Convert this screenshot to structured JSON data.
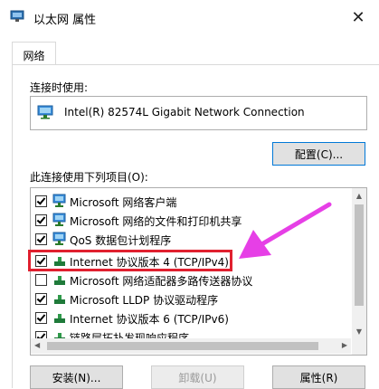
{
  "window": {
    "title": "以太网 属性",
    "close_glyph": "✕"
  },
  "tabs": [
    {
      "label": "网络"
    }
  ],
  "connect_using": {
    "label": "连接时使用:",
    "adapter": "Intel(R) 82574L Gigabit Network Connection",
    "configure_label": "配置(C)..."
  },
  "items_label": "此连接使用下列项目(O):",
  "items": [
    {
      "label": "Microsoft 网络客户端",
      "checked": true
    },
    {
      "label": "Microsoft 网络的文件和打印机共享",
      "checked": true
    },
    {
      "label": "QoS 数据包计划程序",
      "checked": true
    },
    {
      "label": "Internet 协议版本 4 (TCP/IPv4)",
      "checked": true
    },
    {
      "label": "Microsoft 网络适配器多路传送器协议",
      "checked": false
    },
    {
      "label": "Microsoft LLDP 协议驱动程序",
      "checked": true
    },
    {
      "label": "Internet 协议版本 6 (TCP/IPv6)",
      "checked": true
    },
    {
      "label": "链路层拓扑发现响应程序",
      "checked": true
    }
  ],
  "buttons": {
    "install": "安装(N)...",
    "uninstall": "卸载(U)",
    "properties": "属性(R)"
  },
  "colors": {
    "highlight": "#e0202f",
    "arrow": "#e63fe6",
    "accent": "#0078d7"
  }
}
